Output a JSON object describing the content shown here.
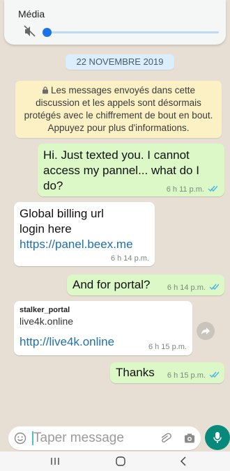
{
  "volume_panel": {
    "title": "Média",
    "muted": true,
    "level": 0.0,
    "icons": [
      "speaker-muted-icon"
    ]
  },
  "chat": {
    "date_chip": "22 NOVEMBRE 2019",
    "encryption_notice": "Les messages envoyés dans cette discussion et les appels sont désormais protégés avec le chiffrement de bout en bout. Appuyez pour plus d'informations.",
    "messages": [
      {
        "direction": "out",
        "text": "Hi. Just texted you. I cannot access my pannel... what do I do?",
        "time": "6 h 11 p.m.",
        "status": "read"
      },
      {
        "direction": "in",
        "text_line1": "Global billing url",
        "text_line2": "login here",
        "link": "https://panel.beex.me",
        "time": "6 h 14 p.m."
      },
      {
        "direction": "out",
        "text": "And for portal?",
        "time": "6 h 14 p.m.",
        "status": "read"
      },
      {
        "direction": "in",
        "preview_title": "stalker_portal",
        "preview_host": "live4k.online",
        "link": "http://live4k.online",
        "time": "6 h 15 p.m."
      },
      {
        "direction": "out",
        "text": "Thanks",
        "time": "6 h 15 p.m.",
        "status": "read"
      }
    ]
  },
  "composer": {
    "placeholder": "Taper message",
    "icons": [
      "emoji-icon",
      "attach-icon",
      "camera-icon",
      "mic-icon"
    ]
  },
  "colors": {
    "outgoing_bubble": "#dcf8c6",
    "incoming_bubble": "#ffffff",
    "mic_button": "#078a7b",
    "link": "#1f6fa8",
    "notice_bg": "#fbf1c4",
    "date_chip_bg": "#dbeefb"
  }
}
